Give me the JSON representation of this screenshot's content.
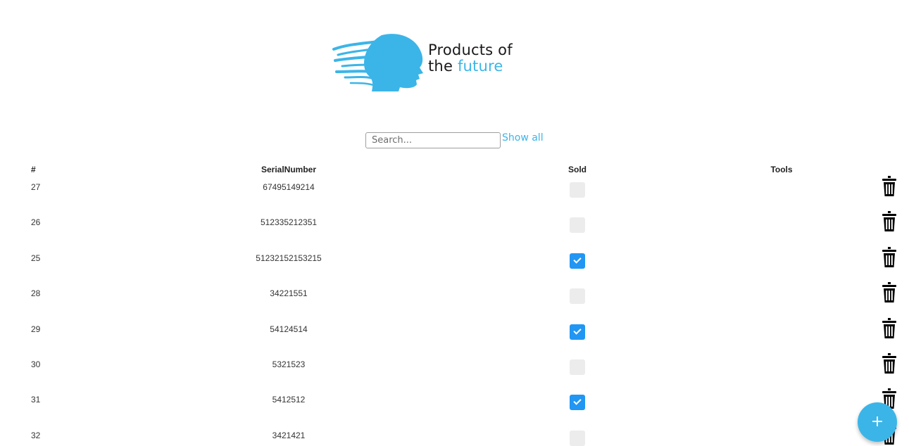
{
  "logo": {
    "line1": "Products of",
    "line2_prefix": "the ",
    "line2_accent": "future",
    "accent_color": "#3bb5e8"
  },
  "search": {
    "placeholder": "Search...",
    "value": "",
    "show_all_label": "Show all"
  },
  "table": {
    "columns": [
      "#",
      "SerialNumber",
      "Sold",
      "Tools"
    ],
    "rows": [
      {
        "id": "27",
        "serial": "67495149214",
        "sold": false
      },
      {
        "id": "26",
        "serial": "512335212351",
        "sold": false
      },
      {
        "id": "25",
        "serial": "51232152153215",
        "sold": true
      },
      {
        "id": "28",
        "serial": "34221551",
        "sold": false
      },
      {
        "id": "29",
        "serial": "54124514",
        "sold": true
      },
      {
        "id": "30",
        "serial": "5321523",
        "sold": false
      },
      {
        "id": "31",
        "serial": "5412512",
        "sold": true
      },
      {
        "id": "32",
        "serial": "3421421",
        "sold": false
      }
    ],
    "tool_icon": "trash-icon"
  },
  "fab": {
    "label": "+",
    "icon": "plus-icon",
    "color": "#3bb5e8"
  },
  "colors": {
    "checkbox_checked": "#2196f3",
    "checkbox_unchecked": "#ececec",
    "link": "#3bb5e8"
  }
}
